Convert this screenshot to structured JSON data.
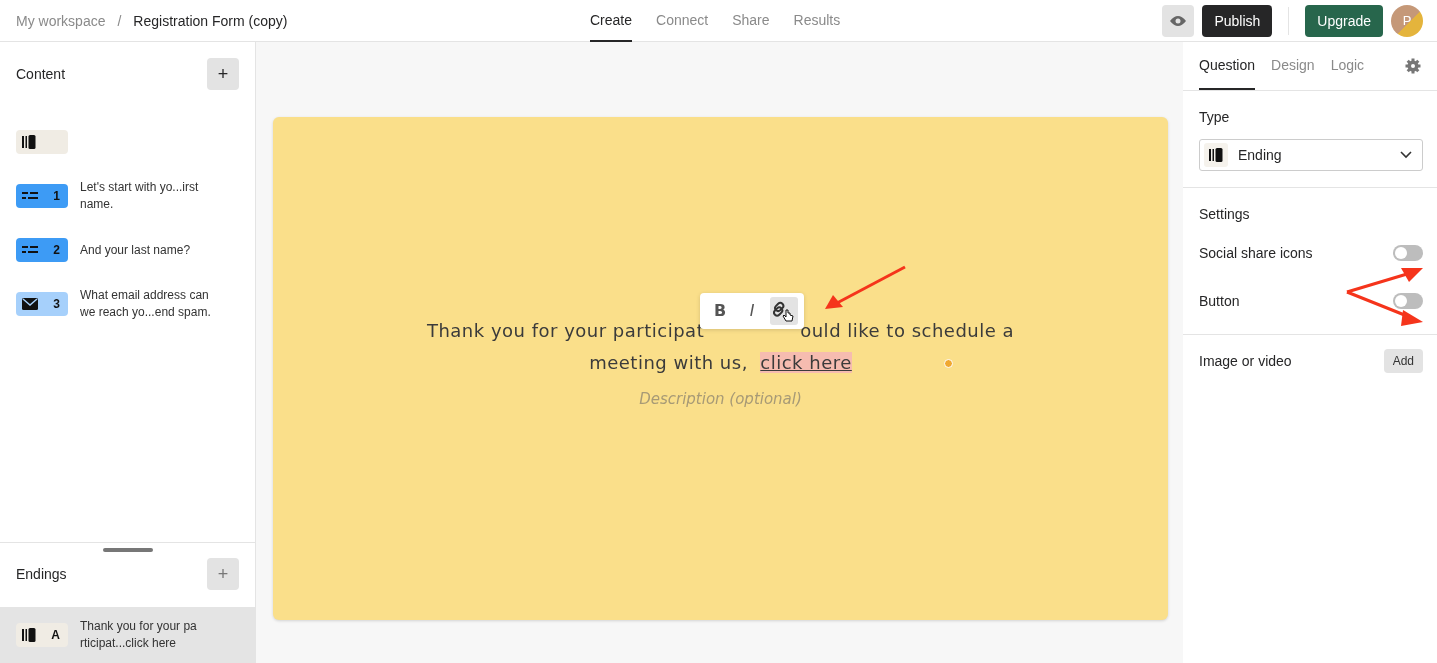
{
  "breadcrumb": {
    "workspace": "My workspace",
    "separator": "/",
    "form": "Registration Form (copy)"
  },
  "nav_tabs": [
    {
      "label": "Create",
      "selected": true
    },
    {
      "label": "Connect",
      "selected": false
    },
    {
      "label": "Share",
      "selected": false
    },
    {
      "label": "Results",
      "selected": false
    }
  ],
  "header_actions": {
    "publish": "Publish",
    "upgrade": "Upgrade",
    "avatar": "P"
  },
  "content": {
    "title": "Content",
    "add": "+",
    "items": [
      {
        "kind": "ending",
        "selected": false
      },
      {
        "kind": "short-text",
        "number": "1",
        "text": "Let's start with yo...irst name.",
        "selected": false
      },
      {
        "kind": "short-text",
        "number": "2",
        "text": "And your last name?",
        "selected": false
      },
      {
        "kind": "email",
        "number": "3",
        "text": "What email address can we reach yo...end spam.",
        "selected": false
      }
    ]
  },
  "endings": {
    "title": "Endings",
    "add": "+",
    "items": [
      {
        "kind": "ending",
        "number": "A",
        "text": "Thank you for your pa rticipat...click here",
        "selected": true
      }
    ]
  },
  "canvas": {
    "heading_before": "Thank you for your participat",
    "heading_after": "ould like to schedule a",
    "heading_line2": "meeting with us, ",
    "link": "click here",
    "description_placeholder": "Description (optional)",
    "toolbar": [
      {
        "label": "B",
        "kind": "bold",
        "selected": false
      },
      {
        "label": "I",
        "kind": "italic",
        "selected": false
      },
      {
        "kind": "link",
        "selected": true
      }
    ]
  },
  "panel": {
    "tabs": [
      {
        "label": "Question",
        "selected": true
      },
      {
        "label": "Design",
        "selected": false
      },
      {
        "label": "Logic",
        "selected": false
      }
    ],
    "type_label": "Type",
    "type_value": "Ending",
    "settings_label": "Settings",
    "settings": [
      {
        "label": "Social share icons",
        "on": false
      },
      {
        "label": "Button",
        "on": false
      }
    ],
    "media_label": "Image or video",
    "media_add": "Add"
  }
}
